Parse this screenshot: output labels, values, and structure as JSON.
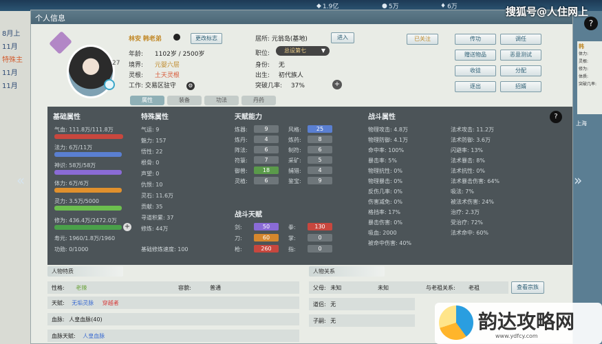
{
  "topbar": {
    "res1": "1.9亿",
    "res2": "5万",
    "res3": "6万"
  },
  "watermark_top": "搜狐号@人住网上",
  "left_strip": [
    "8月上",
    "11月",
    "特殊主",
    "11月",
    "11月"
  ],
  "right_strip": {
    "title": "韩",
    "rows": [
      "体力:",
      "灵根:",
      "修为:",
      "体质:",
      "突破几率:"
    ],
    "bottom": "上海"
  },
  "panel": {
    "title": "个人信息"
  },
  "char": {
    "name_prefix": "林安",
    "name": "韩老弟",
    "badge_level": "27",
    "age_label": "年龄:",
    "age": "1102岁 / 2500岁",
    "realm_label": "境界:",
    "realm": "元婴六层",
    "root_label": "灵根:",
    "root": "土天灵根",
    "work_label": "工作:",
    "work": "交易区驻守"
  },
  "mid_info": {
    "residence_label": "居所:",
    "residence": "元翁岛(基地)",
    "enter_btn": "进入",
    "position_label": "职位:",
    "position": "总设第七",
    "identity_label": "身份:",
    "identity": "无",
    "birth_label": "出生:",
    "birth": "初代族人",
    "break_label": "突破几率:",
    "break": "37%"
  },
  "top_btns": {
    "rename": "更改标志",
    "set": "已关注"
  },
  "right_btns": [
    "传功",
    "调任",
    "赠送物品",
    "恶意测试",
    "收徒",
    "分配",
    "逐出",
    "招婿"
  ],
  "tabs": [
    "属性",
    "装备",
    "功法",
    "丹药"
  ],
  "basic": {
    "title": "基础属性",
    "rows": [
      "气血: 111.8万/111.8万",
      "法力: 6万/11万",
      "神识: 58万/58万",
      "体力: 6万/6万",
      "灵力: 3.5万/5000",
      "修为: 436.4万/2472.0万",
      "寿元: 1960/1.8万/1960",
      "功勋: 0/1000"
    ]
  },
  "special": {
    "title": "特殊属性",
    "rows": [
      "气运: 9",
      "魅力: 157",
      "悟性: 22",
      "根骨: 0",
      "声望: 0",
      "仇恨: 10",
      "灵石: 11.6万",
      "贡献: 35",
      "寻道积累: 37",
      "修炼: 44万"
    ],
    "footer": "基础修炼速度: 100"
  },
  "talents": {
    "title": "天赋能力",
    "rows": [
      [
        "炼器:",
        "9"
      ],
      [
        "炼丹:",
        "4"
      ],
      [
        "阵法:",
        "6"
      ],
      [
        "符箓:",
        "7"
      ],
      [
        "御兽:",
        "18"
      ],
      [
        "灵植:",
        "6"
      ]
    ],
    "rows2": [
      [
        "风格:",
        "25"
      ],
      [
        "炼药:",
        "8"
      ],
      [
        "制符:",
        "6"
      ],
      [
        "采矿:",
        "5"
      ],
      [
        "捕猎:",
        "4"
      ],
      [
        "鉴宝:",
        "9"
      ]
    ]
  },
  "combat_skill": {
    "title": "战斗天赋",
    "rows": [
      [
        "剑:",
        "50"
      ],
      [
        "刀:",
        "60"
      ],
      [
        "枪:",
        "260"
      ]
    ],
    "rows2": [
      [
        "拳:",
        "130"
      ],
      [
        "掌:",
        "0"
      ],
      [
        "指:",
        "0"
      ]
    ]
  },
  "combat_attr": {
    "title": "战斗属性",
    "col1": [
      "物理攻击: 4.8万",
      "物理防御: 4.1万",
      "命中率: 100%",
      "暴击率: 5%",
      "物理抗性: 0%",
      "物理暴击: 0%",
      "反伤几率: 0%",
      "伤害减免: 0%",
      "格挡率: 17%",
      "暴击伤害: 0%",
      "吸血: 2000",
      "被命中伤害: 40%"
    ],
    "col2": [
      "法术攻击: 11.2万",
      "法术防御: 3.6万",
      "闪避率: 13%",
      "法术暴击: 8%",
      "法术抗性: 0%",
      "法术暴击伤害: 64%",
      "吸法: 7%",
      "被法术伤害: 24%",
      "治疗: 2.3万",
      "受治疗: 72%",
      "法术命中: 60%"
    ]
  },
  "person": {
    "title": "人物特质",
    "rows": [
      [
        "性格:",
        "老辣",
        "容貌:",
        "普通"
      ],
      [
        "天赋:",
        "无垢灵脉",
        "穿越者",
        ""
      ],
      [
        "血脉:",
        "人皇血脉(40)",
        "",
        ""
      ],
      [
        "血脉天赋:",
        "人皇血脉",
        "",
        ""
      ]
    ]
  },
  "relation": {
    "title": "人物关系",
    "rows": [
      [
        "父母:",
        "未知",
        "未知",
        "与老祖关系:",
        "老祖"
      ],
      [
        "道侣:",
        "无",
        "",
        "",
        ""
      ],
      [
        "子嗣:",
        "无",
        "",
        "",
        ""
      ]
    ],
    "btn": "查看宗族"
  },
  "logo": {
    "text": "韵达攻略网",
    "url": "www.ydfcy.com"
  },
  "colors": {
    "hp": "#c8473e",
    "mp": "#5a7fd1",
    "god": "#8a6bd6",
    "stamina": "#e0902d",
    "spirit": "#6cbf4e",
    "cult": "#4aa04a"
  }
}
